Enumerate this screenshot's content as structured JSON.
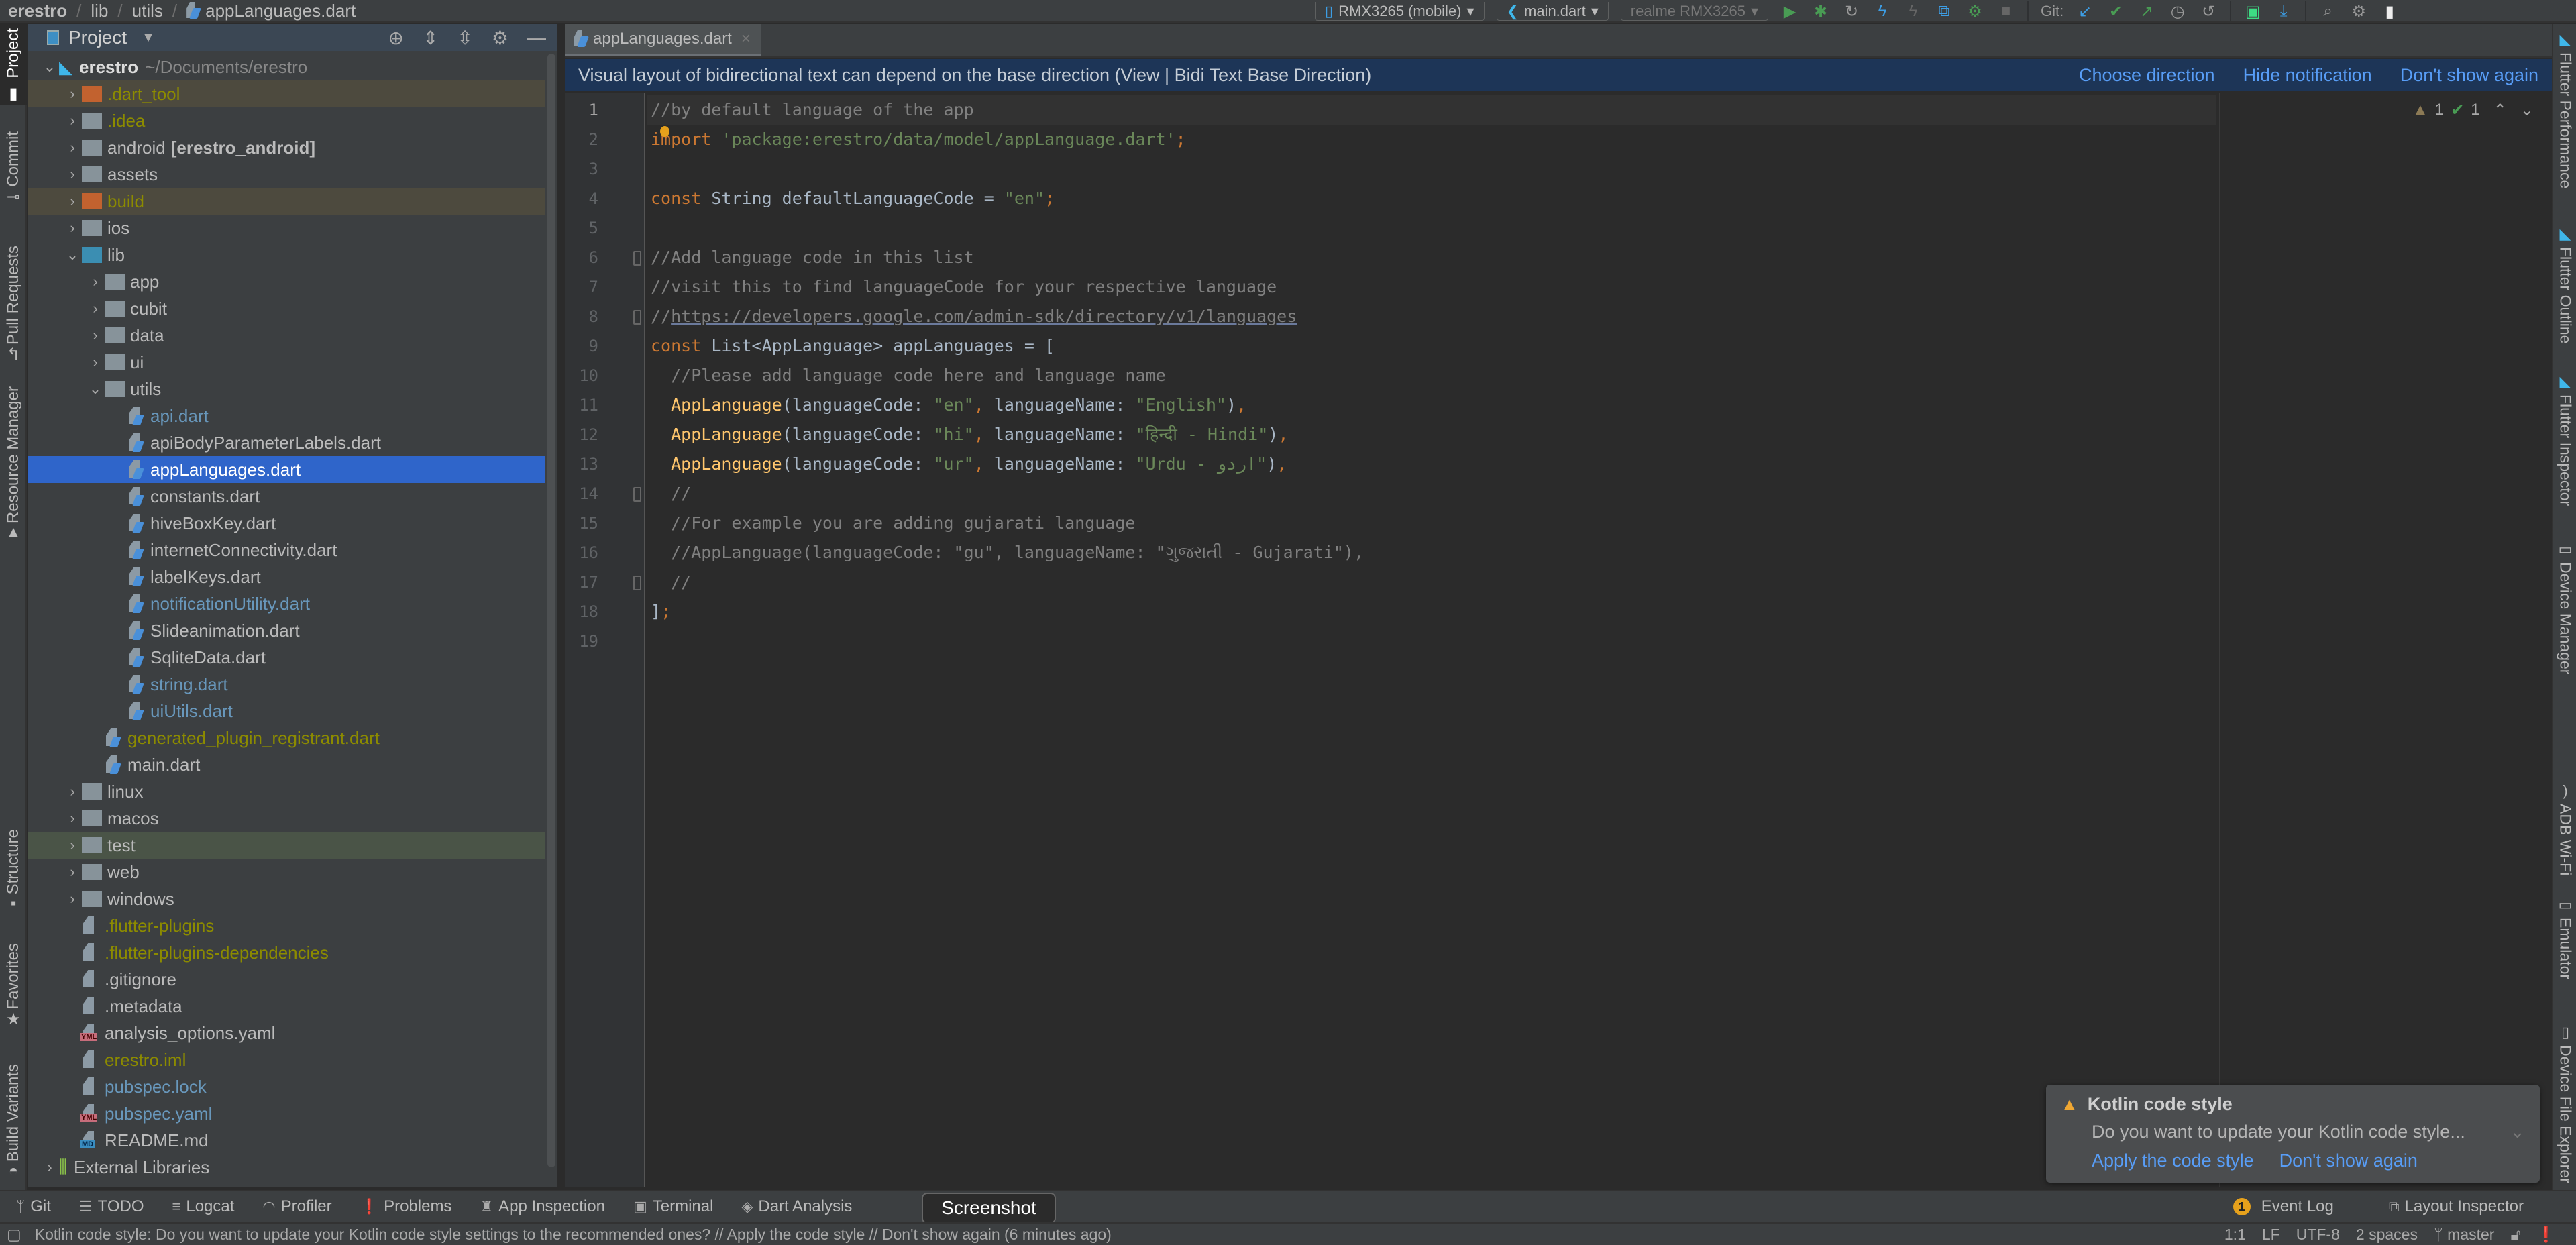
{
  "breadcrumb": [
    "erestro",
    "lib",
    "utils",
    "appLanguages.dart"
  ],
  "toolbar": {
    "device_selector": "RMX3265 (mobile)",
    "run_config": "main.dart",
    "emulator_selector": "realme RMX3265",
    "git_label": "Git:",
    "icons": [
      "run-icon",
      "debug-icon",
      "attach-icon",
      "hot-reload-icon",
      "hot-restart-icon",
      "flutter-attach-icon",
      "profile-icon",
      "stop-icon",
      "git-update-icon",
      "git-commit-icon",
      "git-push-icon",
      "history-icon",
      "rollback-icon",
      "device-manager-icon",
      "sdk-download-icon",
      "search-icon",
      "settings-icon",
      "account-icon"
    ]
  },
  "left_strip": [
    "Project",
    "Commit",
    "Pull Requests",
    "Resource Manager",
    "Structure",
    "Favorites",
    "Build Variants"
  ],
  "project_panel": {
    "title": "Project",
    "tools": [
      "locate-icon",
      "expand-all-icon",
      "collapse-all-icon",
      "gear-icon",
      "minimize-icon"
    ],
    "tree": [
      {
        "label": "erestro",
        "extra": "~/Documents/erestro",
        "depth": 0,
        "type": "root",
        "expanded": true,
        "color": "white",
        "bold": true
      },
      {
        "label": ".dart_tool",
        "depth": 1,
        "type": "folder-orange",
        "expanded": false,
        "color": "olive",
        "highlight": "brown"
      },
      {
        "label": ".idea",
        "depth": 1,
        "type": "folder-gray",
        "expanded": false,
        "color": "olive"
      },
      {
        "label": "android",
        "extra_bold": "[erestro_android]",
        "depth": 1,
        "type": "folder-gray",
        "expanded": false,
        "color": "default"
      },
      {
        "label": "assets",
        "depth": 1,
        "type": "folder-gray",
        "expanded": false,
        "color": "default"
      },
      {
        "label": "build",
        "depth": 1,
        "type": "folder-orange",
        "expanded": false,
        "color": "olive",
        "highlight": "brown"
      },
      {
        "label": "ios",
        "depth": 1,
        "type": "folder-gray",
        "expanded": false,
        "color": "default"
      },
      {
        "label": "lib",
        "depth": 1,
        "type": "folder-blue",
        "expanded": true,
        "color": "default"
      },
      {
        "label": "app",
        "depth": 2,
        "type": "folder-gray",
        "expanded": false,
        "color": "default"
      },
      {
        "label": "cubit",
        "depth": 2,
        "type": "folder-gray",
        "expanded": false,
        "color": "default"
      },
      {
        "label": "data",
        "depth": 2,
        "type": "folder-gray",
        "expanded": false,
        "color": "default"
      },
      {
        "label": "ui",
        "depth": 2,
        "type": "folder-gray",
        "expanded": false,
        "color": "default"
      },
      {
        "label": "utils",
        "depth": 2,
        "type": "folder-gray",
        "expanded": true,
        "color": "default"
      },
      {
        "label": "api.dart",
        "depth": 3,
        "type": "dart",
        "color": "blue"
      },
      {
        "label": "apiBodyParameterLabels.dart",
        "depth": 3,
        "type": "dart",
        "color": "default"
      },
      {
        "label": "appLanguages.dart",
        "depth": 3,
        "type": "dart",
        "color": "default",
        "selected": true
      },
      {
        "label": "constants.dart",
        "depth": 3,
        "type": "dart",
        "color": "default"
      },
      {
        "label": "hiveBoxKey.dart",
        "depth": 3,
        "type": "dart",
        "color": "default"
      },
      {
        "label": "internetConnectivity.dart",
        "depth": 3,
        "type": "dart",
        "color": "default"
      },
      {
        "label": "labelKeys.dart",
        "depth": 3,
        "type": "dart",
        "color": "default"
      },
      {
        "label": "notificationUtility.dart",
        "depth": 3,
        "type": "dart",
        "color": "blue"
      },
      {
        "label": "Slideanimation.dart",
        "depth": 3,
        "type": "dart",
        "color": "default"
      },
      {
        "label": "SqliteData.dart",
        "depth": 3,
        "type": "dart",
        "color": "default"
      },
      {
        "label": "string.dart",
        "depth": 3,
        "type": "dart",
        "color": "blue"
      },
      {
        "label": "uiUtils.dart",
        "depth": 3,
        "type": "dart",
        "color": "blue"
      },
      {
        "label": "generated_plugin_registrant.dart",
        "depth": 2,
        "type": "dart",
        "color": "olive"
      },
      {
        "label": "main.dart",
        "depth": 2,
        "type": "dart",
        "color": "default"
      },
      {
        "label": "linux",
        "depth": 1,
        "type": "folder-gray",
        "expanded": false,
        "color": "default"
      },
      {
        "label": "macos",
        "depth": 1,
        "type": "folder-gray",
        "expanded": false,
        "color": "default"
      },
      {
        "label": "test",
        "depth": 1,
        "type": "folder-gray",
        "expanded": false,
        "color": "default",
        "highlight": "green"
      },
      {
        "label": "web",
        "depth": 1,
        "type": "folder-gray",
        "expanded": false,
        "color": "default"
      },
      {
        "label": "windows",
        "depth": 1,
        "type": "folder-gray",
        "expanded": false,
        "color": "default"
      },
      {
        "label": ".flutter-plugins",
        "depth": 1,
        "type": "file",
        "color": "olive"
      },
      {
        "label": ".flutter-plugins-dependencies",
        "depth": 1,
        "type": "file",
        "color": "olive"
      },
      {
        "label": ".gitignore",
        "depth": 1,
        "type": "file",
        "color": "default"
      },
      {
        "label": ".metadata",
        "depth": 1,
        "type": "file",
        "color": "default"
      },
      {
        "label": "analysis_options.yaml",
        "depth": 1,
        "type": "yml",
        "color": "default"
      },
      {
        "label": "erestro.iml",
        "depth": 1,
        "type": "file",
        "color": "olive"
      },
      {
        "label": "pubspec.lock",
        "depth": 1,
        "type": "file",
        "color": "blue"
      },
      {
        "label": "pubspec.yaml",
        "depth": 1,
        "type": "yml",
        "color": "blue"
      },
      {
        "label": "README.md",
        "depth": 1,
        "type": "md",
        "color": "default"
      },
      {
        "label": "External Libraries",
        "depth": 0,
        "type": "libs",
        "expanded": false,
        "color": "default"
      }
    ]
  },
  "editor": {
    "tab_label": "appLanguages.dart",
    "notification": {
      "message": "Visual layout of bidirectional text can depend on the base direction (View | Bidi Text Base Direction)",
      "actions": [
        "Choose direction",
        "Hide notification",
        "Don't show again"
      ]
    },
    "inspection": {
      "warnings": "1",
      "weak_warnings": "1"
    },
    "current_line": 1,
    "lines": [
      [
        [
          "cm",
          "//by default language of the app"
        ]
      ],
      [
        [
          "k",
          "import "
        ],
        [
          "s",
          "'package:erestro/data/model/appLanguage.dart'"
        ],
        [
          "k",
          ";"
        ]
      ],
      [],
      [
        [
          "k",
          "const "
        ],
        [
          "id",
          "String defaultLanguageCode = "
        ],
        [
          "s",
          "\"en\""
        ],
        [
          "k",
          ";"
        ]
      ],
      [],
      [
        [
          "cm",
          "//Add language code in this list"
        ]
      ],
      [
        [
          "cm",
          "//visit this to find languageCode for your respective language"
        ]
      ],
      [
        [
          "cm",
          "//"
        ],
        [
          "link",
          "https://developers.google.com/admin-sdk/directory/v1/languages"
        ]
      ],
      [
        [
          "k",
          "const "
        ],
        [
          "id",
          "List<AppLanguage> appLanguages = ["
        ]
      ],
      [
        [
          "cm",
          "  //Please add language code here and language name"
        ]
      ],
      [
        [
          "id",
          "  "
        ],
        [
          "fn",
          "AppLanguage"
        ],
        [
          "id",
          "(languageCode: "
        ],
        [
          "s",
          "\"en\""
        ],
        [
          "k",
          ", "
        ],
        [
          "id",
          "languageName: "
        ],
        [
          "s",
          "\"English\""
        ],
        [
          "id",
          ")"
        ],
        [
          "k",
          ","
        ]
      ],
      [
        [
          "id",
          "  "
        ],
        [
          "fn",
          "AppLanguage"
        ],
        [
          "id",
          "(languageCode: "
        ],
        [
          "s",
          "\"hi\""
        ],
        [
          "k",
          ", "
        ],
        [
          "id",
          "languageName: "
        ],
        [
          "s",
          "\"हिन्दी - Hindi\""
        ],
        [
          "id",
          ")"
        ],
        [
          "k",
          ","
        ]
      ],
      [
        [
          "id",
          "  "
        ],
        [
          "fn",
          "AppLanguage"
        ],
        [
          "id",
          "(languageCode: "
        ],
        [
          "s",
          "\"ur\""
        ],
        [
          "k",
          ", "
        ],
        [
          "id",
          "languageName: "
        ],
        [
          "s",
          "\"Urdu - اردو\""
        ],
        [
          "id",
          ")"
        ],
        [
          "k",
          ","
        ]
      ],
      [
        [
          "cm",
          "  //"
        ]
      ],
      [
        [
          "cm",
          "  //For example you are adding gujarati language"
        ]
      ],
      [
        [
          "cm",
          "  //AppLanguage(languageCode: \"gu\", languageName: \"ગુજરાતી - Gujarati\"),"
        ]
      ],
      [
        [
          "cm",
          "  //"
        ]
      ],
      [
        [
          "id",
          "]"
        ],
        [
          "k",
          ";"
        ]
      ],
      []
    ]
  },
  "right_strip": [
    "Flutter Performance",
    "Flutter Outline",
    "Flutter Inspector",
    "Device Manager",
    "ADB Wi-Fi",
    "Emulator",
    "Device File Explorer"
  ],
  "bottom_tools": {
    "left": [
      {
        "label": "Git",
        "icon": "branch-icon"
      },
      {
        "label": "TODO",
        "icon": "list-icon"
      },
      {
        "label": "Logcat",
        "icon": "logcat-icon"
      },
      {
        "label": "Profiler",
        "icon": "gauge-icon"
      },
      {
        "label": "Problems",
        "icon": "warning-circle-icon"
      },
      {
        "label": "App Inspection",
        "icon": "inspection-icon"
      },
      {
        "label": "Terminal",
        "icon": "terminal-icon"
      },
      {
        "label": "Dart Analysis",
        "icon": "dart-analysis-icon"
      }
    ],
    "right": [
      {
        "label": "Event Log",
        "badge": "1"
      },
      {
        "label": "Layout Inspector",
        "icon": "layout-inspector-icon"
      }
    ],
    "tooltip": "Screenshot"
  },
  "status_bar": {
    "message": "Kotlin code style: Do you want to update your Kotlin code style settings to the recommended ones? // Apply the code style // Don't show again (6 minutes ago)",
    "position": "1:1",
    "line_sep": "LF",
    "encoding": "UTF-8",
    "indent": "2 spaces",
    "branch": "master"
  },
  "balloon": {
    "title": "Kotlin code style",
    "body": "Do you want to update your Kotlin code style...",
    "actions": [
      "Apply the code style",
      "Don't show again"
    ]
  }
}
